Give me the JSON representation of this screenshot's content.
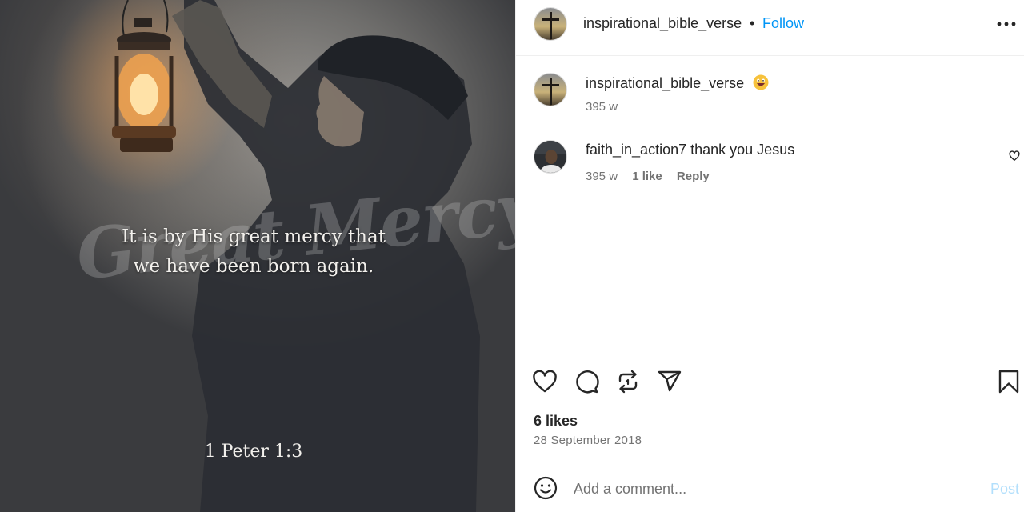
{
  "post": {
    "quote_line1": "It is by His great mercy that",
    "quote_line2": "we have been born again.",
    "reference": "1 Peter 1:3",
    "watermark": "Great Mercy"
  },
  "header": {
    "username": "inspirational_bible_verse",
    "separator": "•",
    "follow_label": "Follow",
    "more_icon": "more-horizontal-icon"
  },
  "caption": {
    "username": "inspirational_bible_verse",
    "emoji_icon": "grinning-face-emoji",
    "time": "395 w"
  },
  "comment": {
    "username": "faith_in_action7",
    "text": "thank you Jesus",
    "time": "395 w",
    "likes": "1 like",
    "reply_label": "Reply"
  },
  "actions": {
    "likes_text": "6 likes",
    "date": "28 September 2018"
  },
  "add_comment": {
    "placeholder": "Add a comment...",
    "post_label": "Post"
  },
  "colors": {
    "link_blue": "#0095f6",
    "post_disabled": "#b2dffc",
    "secondary_text": "#737373"
  }
}
